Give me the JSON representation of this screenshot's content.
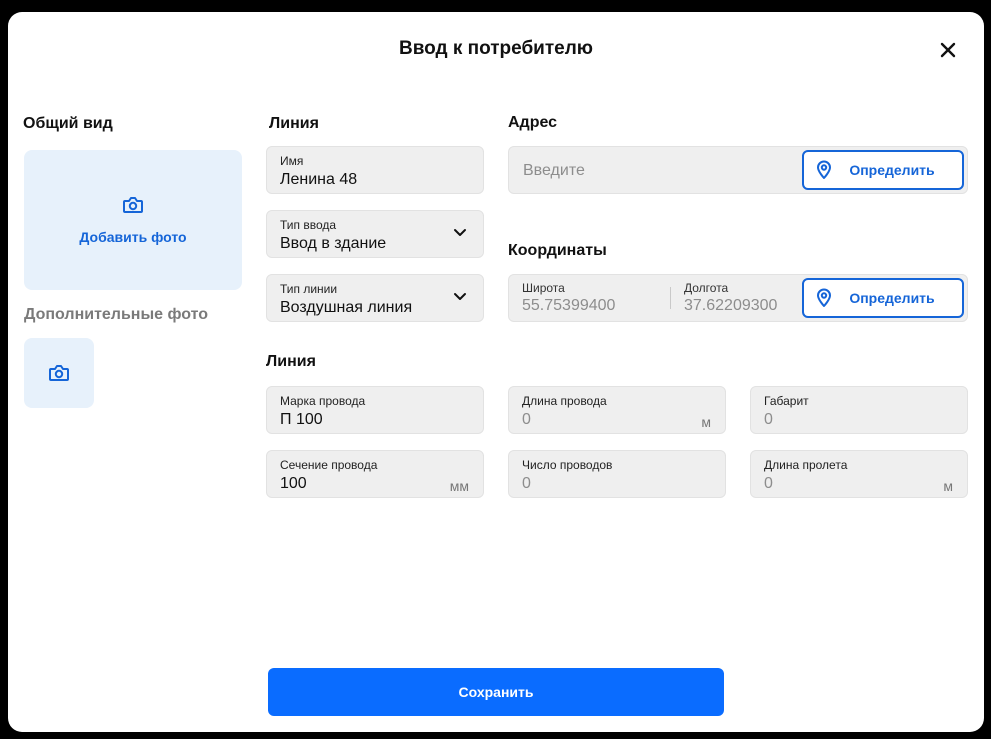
{
  "modal": {
    "title": "Ввод к потребителю",
    "close_icon": "close-icon"
  },
  "photos": {
    "main_title": "Общий вид",
    "add_photo_label": "Добавить фото",
    "additional_title": "Дополнительные фото",
    "camera_icon": "camera-icon"
  },
  "line": {
    "title": "Линия",
    "name": {
      "label": "Имя",
      "value": "Ленина 48"
    },
    "input_type": {
      "label": "Тип ввода",
      "value": "Ввод в здание"
    },
    "line_type": {
      "label": "Тип линии",
      "value": "Воздушная линия"
    }
  },
  "address": {
    "title": "Адрес",
    "placeholder": "Введите",
    "detect_label": "Определить"
  },
  "coordinates": {
    "title": "Координаты",
    "latitude_label": "Широта",
    "latitude_value": "55.75399400",
    "longitude_label": "Долгота",
    "longitude_value": "37.62209300",
    "detect_label": "Определить"
  },
  "wire": {
    "title": "Линия",
    "mark": {
      "label": "Марка провода",
      "value": "П 100"
    },
    "length": {
      "label": "Длина провода",
      "value": "0",
      "unit": "м"
    },
    "gabarit": {
      "label": "Габарит",
      "value": "0"
    },
    "section": {
      "label": "Сечение провода",
      "value": "100",
      "unit": "мм"
    },
    "count": {
      "label": "Число проводов",
      "value": "0"
    },
    "span": {
      "label": "Длина пролета",
      "value": "0",
      "unit": "м"
    }
  },
  "footer": {
    "save_label": "Сохранить"
  },
  "colors": {
    "accent": "#0a6cff",
    "accent_text": "#1565d8",
    "photo_bg": "#e7f1fb",
    "field_bg": "#efefef"
  }
}
